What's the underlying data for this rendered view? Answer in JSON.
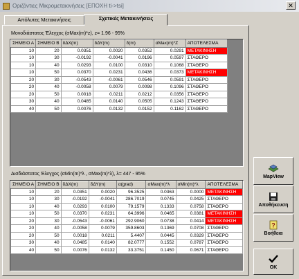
{
  "window": {
    "title": "Οριζόντιες Μικρομετακινήσεις [ΕΠΟΧΗ ti->tsi]",
    "close_glyph": "✕"
  },
  "tabs": [
    {
      "label": "Απόλυτες Μετακινήσεις"
    },
    {
      "label": "Σχετικές Μετακινήσεις"
    }
  ],
  "table1": {
    "caption": "Μονοδιάστατος Έλεγχος (σMax(m)*z), z= 1.96 - 95%",
    "headers": [
      "ΣΗΜΕΙΟ Α",
      "ΣΗΜΕΙΟ Β",
      "δΔΧ(m)",
      "δΔΥ(m)",
      "δ(m)",
      "σMax(m)*Z",
      "ΑΠΟΤΕΛΕΣΜΑ"
    ],
    "rows": [
      [
        "10",
        "20",
        "0.0351",
        "0.0020",
        "0.0352",
        "0.0291",
        "ΜΕΤΑΚΙΝΗΣΗ"
      ],
      [
        "10",
        "30",
        "-0.0192",
        "-0.0041",
        "0.0196",
        "0.0597",
        "ΣΤΑΘΕΡΟ"
      ],
      [
        "10",
        "40",
        "0.0293",
        "0.0100",
        "0.0310",
        "0.1068",
        "ΣΤΑΘΕΡΟ"
      ],
      [
        "10",
        "50",
        "0.0370",
        "0.0231",
        "0.0436",
        "0.0373",
        "ΜΕΤΑΚΙΝΗΣΗ"
      ],
      [
        "20",
        "30",
        "-0.0543",
        "-0.0061",
        "0.0546",
        "0.0591",
        "ΣΤΑΘΕΡΟ"
      ],
      [
        "20",
        "40",
        "-0.0058",
        "0.0079",
        "0.0098",
        "0.1096",
        "ΣΤΑΘΕΡΟ"
      ],
      [
        "20",
        "50",
        "0.0018",
        "0.0211",
        "0.0212",
        "0.0356",
        "ΣΤΑΘΕΡΟ"
      ],
      [
        "30",
        "40",
        "0.0485",
        "0.0140",
        "0.0505",
        "0.1243",
        "ΣΤΑΘΕΡΟ"
      ],
      [
        "40",
        "50",
        "0.0076",
        "0.0132",
        "0.0152",
        "0.1162",
        "ΣΤΑΘΕΡΟ"
      ]
    ]
  },
  "table2": {
    "caption": "Δισδιάστατος Έλεγχος (σMin(m)*λ , σMax(m)*λ), λ= 447 - 95%",
    "headers": [
      "ΣΗΜΕΙΟ Α",
      "ΣΗΜΕΙΟ Β",
      "δΔΧ(m)",
      "δΔΥ(m)",
      "α(grad)",
      "σMax(m)*λ",
      "σMin(m)*λ",
      "ΑΠΟΤΕΛΕΣΜΑ"
    ],
    "rows": [
      [
        "10",
        "20",
        "0.0351",
        "0.0020",
        "96.3525",
        "0.0363",
        "0.0000",
        "ΜΕΤΑΚΙΝΗΣΗ"
      ],
      [
        "10",
        "30",
        "-0.0192",
        "-0.0041",
        "286.7019",
        "0.0745",
        "0.0425",
        "ΣΤΑΘΕΡΟ"
      ],
      [
        "10",
        "40",
        "0.0293",
        "0.0100",
        "79.1579",
        "0.1333",
        "0.0758",
        "ΣΤΑΘΕΡΟ"
      ],
      [
        "10",
        "50",
        "0.0370",
        "0.0231",
        "64.3996",
        "0.0465",
        "0.0381",
        "ΜΕΤΑΚΙΝΗΣΗ"
      ],
      [
        "20",
        "30",
        "-0.0543",
        "-0.0061",
        "292.9060",
        "0.0738",
        "0.0414",
        "ΜΕΤΑΚΙΝΗΣΗ"
      ],
      [
        "20",
        "40",
        "-0.0058",
        "0.0079",
        "359.8603",
        "0.1369",
        "0.0708",
        "ΣΤΑΘΕΡΟ"
      ],
      [
        "20",
        "50",
        "0.0018",
        "0.0211",
        "5.4407",
        "0.0445",
        "0.0329",
        "ΣΤΑΘΕΡΟ"
      ],
      [
        "30",
        "40",
        "0.0485",
        "0.0140",
        "82.0777",
        "0.1552",
        "0.0787",
        "ΣΤΑΘΕΡΟ"
      ],
      [
        "40",
        "50",
        "0.0076",
        "0.0132",
        "33.3751",
        "0.1450",
        "0.0671",
        "ΣΤΑΘΕΡΟ"
      ]
    ]
  },
  "buttons": {
    "mapview": "MapView",
    "save": "Αποθήκευση",
    "help": "Βοήθεια",
    "ok": "OK"
  },
  "colors": {
    "movement_cell": "#ff0000"
  }
}
